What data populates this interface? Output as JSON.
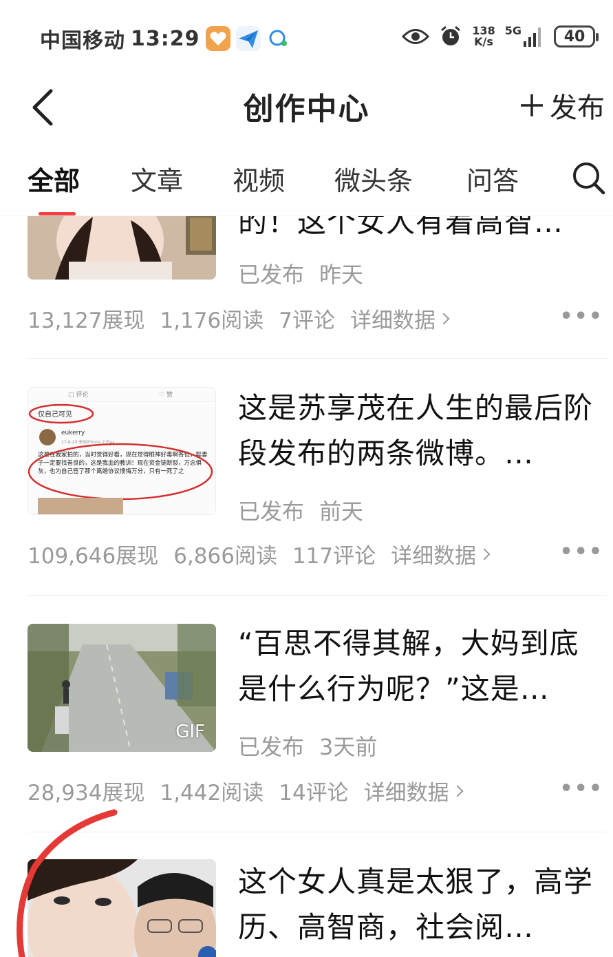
{
  "status_bar": {
    "carrier": "中国移动",
    "time": "13:29",
    "net_speed_value": "138",
    "net_speed_unit": "K/s",
    "network": "5G",
    "battery": "40"
  },
  "header": {
    "title": "创作中心",
    "publish_label": "发布"
  },
  "tabs": [
    {
      "label": "全部",
      "active": true
    },
    {
      "label": "文章"
    },
    {
      "label": "视频"
    },
    {
      "label": "微头条"
    },
    {
      "label": "问答"
    }
  ],
  "items": [
    {
      "title": "的！这个女人有着高智…",
      "status": "已发布",
      "time": "昨天",
      "impressions": "13,127展现",
      "reads": "1,176阅读",
      "comments": "7评论",
      "detail": "详细数据"
    },
    {
      "title": "这是苏享茂在人生的最后阶段发布的两条微博。…",
      "status": "已发布",
      "time": "前天",
      "impressions": "109,646展现",
      "reads": "6,866阅读",
      "comments": "117评论",
      "detail": "详细数据",
      "thumb_text": {
        "tab1": "评论",
        "tab2": "赞",
        "visibility": "仅自己可见",
        "user": "eukerry",
        "date": "17-8-20 来自iPhone 7 Plus",
        "body": "这是在我家拍的，当时觉得好看，现在觉得眼神好毒啊各位，娶妻子一定要找善良的，这是我血的教训！现在资金链断裂，万念俱灰，也为自己签了那个离婚协议懊悔万分，只有一死了之"
      }
    },
    {
      "title": "“百思不得其解，大妈到底是什么行为呢？”这是…",
      "status": "已发布",
      "time": "3天前",
      "impressions": "28,934展现",
      "reads": "1,442阅读",
      "comments": "14评论",
      "detail": "详细数据",
      "badge": "GIF"
    },
    {
      "title": "这个女人真是太狠了，高学历、高智商，社会阅…"
    }
  ],
  "colors": {
    "accent": "#f04142",
    "meta_text": "#9a9a9a",
    "title_text": "#111111"
  }
}
